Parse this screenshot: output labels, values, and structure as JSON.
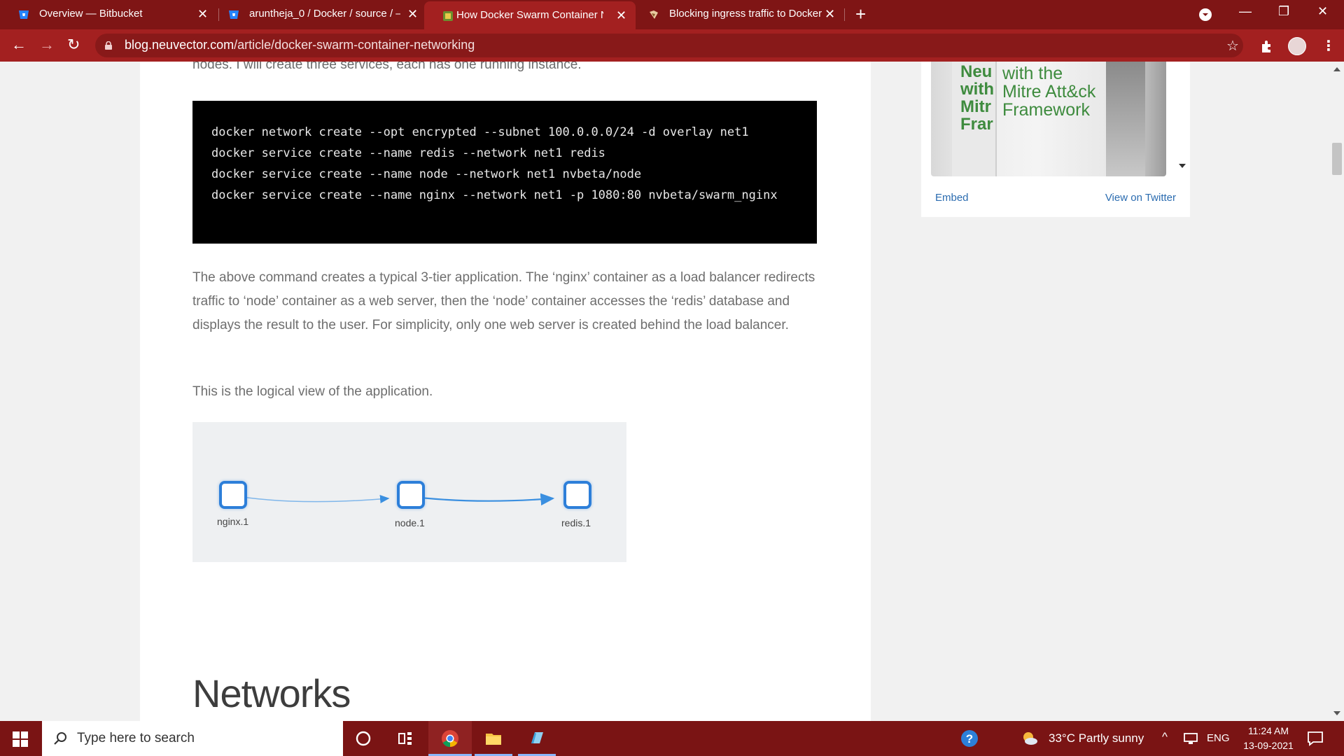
{
  "browser": {
    "tabs": [
      {
        "title": "Overview — Bitbucket",
        "active": false
      },
      {
        "title": "aruntheja_0 / Docker / source / —",
        "active": false
      },
      {
        "title": "How Docker Swarm Container Ne",
        "active": true
      },
      {
        "title": "Blocking ingress traffic to Docker",
        "active": false
      }
    ],
    "url_host": "blog.neuvector.com",
    "url_path": "/article/docker-swarm-container-networking"
  },
  "article": {
    "intro_cut": "nodes. I will create three services, each has one running instance.",
    "code_lines": [
      "docker network create --opt encrypted --subnet 100.0.0.0/24 -d overlay net1",
      "",
      "docker service create --name redis --network net1 redis",
      "docker service create --name node --network net1 nvbeta/node",
      "docker service create --name nginx --network net1 -p 1080:80 nvbeta/swarm_nginx"
    ],
    "para1": "The above command creates a typical 3-tier application. The ‘nginx’ container as a load balancer redirects traffic to ‘node’ container as a web server, then the ‘node’ container accesses the ‘redis’ database and displays the result to the user. For simplicity, only one web server is created behind the load balancer.",
    "para2": "This is the logical view of the application.",
    "diagram_nodes": [
      "nginx.1",
      "node.1",
      "redis.1"
    ],
    "heading": "Networks"
  },
  "sidebar": {
    "widget_text_left": "Neu\nwith\nMitr\nFrar",
    "widget_text_right": "with the\nMitre Att&ck\nFramework",
    "embed": "Embed",
    "view_on_twitter": "View on Twitter"
  },
  "taskbar": {
    "search_placeholder": "Type here to search",
    "weather": "33°C  Partly sunny",
    "lang": "ENG",
    "time": "11:24 AM",
    "date": "13-09-2021"
  },
  "colors": {
    "chrome": "#a32020",
    "tabstrip": "#7f1515",
    "taskbar": "#7a1414",
    "link": "#2b6cb0",
    "diagram_node": "#2d7fd9"
  }
}
